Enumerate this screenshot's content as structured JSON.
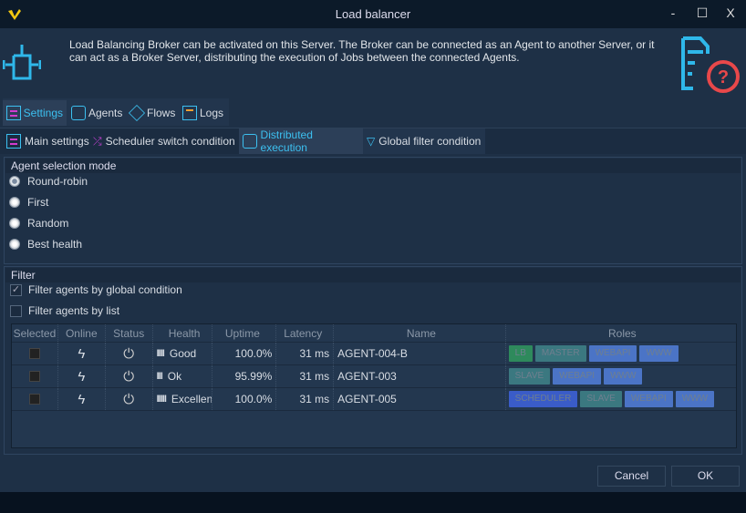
{
  "window": {
    "title": "Load balancer",
    "minimize": "-",
    "maximize": "☐",
    "close": "X"
  },
  "header": {
    "description": "Load Balancing Broker can be activated on this Server. The Broker can be connected as an Agent to another Server, or it can act as a Broker Server, distributing the execution of Jobs between the connected Agents."
  },
  "tabs": [
    {
      "label": "Settings",
      "selected": true
    },
    {
      "label": "Agents"
    },
    {
      "label": "Flows"
    },
    {
      "label": "Logs"
    }
  ],
  "subtabs": [
    {
      "label": "Main settings"
    },
    {
      "label": "Scheduler switch condition"
    },
    {
      "label": "Distributed execution",
      "selected": true
    },
    {
      "label": "Global filter condition"
    }
  ],
  "selection_mode": {
    "label": "Agent selection mode",
    "options": [
      "Round-robin",
      "First",
      "Random",
      "Best health"
    ],
    "selected": "Round-robin"
  },
  "filter": {
    "label": "Filter",
    "global": {
      "label": "Filter agents by global condition",
      "checked": true
    },
    "list": {
      "label": "Filter agents by list",
      "checked": false
    }
  },
  "grid": {
    "columns": [
      "Selected",
      "Online",
      "Status",
      "Health",
      "Uptime",
      "Latency",
      "Name",
      "Roles"
    ],
    "rows": [
      {
        "bars": "IIII",
        "health": "Good",
        "uptime": "100.0%",
        "latency": "31 ms",
        "name": "AGENT-004-B",
        "roles": [
          "LB",
          "MASTER",
          "WEBAPI",
          "WWW"
        ]
      },
      {
        "bars": "III",
        "health": "Ok",
        "uptime": "95.99%",
        "latency": "31 ms",
        "name": "AGENT-003",
        "roles": [
          "SLAVE",
          "WEBAPI",
          "WWW"
        ]
      },
      {
        "bars": "IIIII",
        "health": "Excellent",
        "uptime": "100.0%",
        "latency": "31 ms",
        "name": "AGENT-005",
        "roles": [
          "SCHEDULER",
          "SLAVE",
          "WEBAPI",
          "WWW"
        ]
      }
    ]
  },
  "role_colors": {
    "LB": "#2e8a5c",
    "MASTER": "#3b7880",
    "SLAVE": "#3b7880",
    "WEBAPI": "#4b74c6",
    "WWW": "#4b74c6",
    "SCHEDULER": "#3a5cc8"
  },
  "buttons": {
    "cancel": "Cancel",
    "ok": "OK"
  }
}
